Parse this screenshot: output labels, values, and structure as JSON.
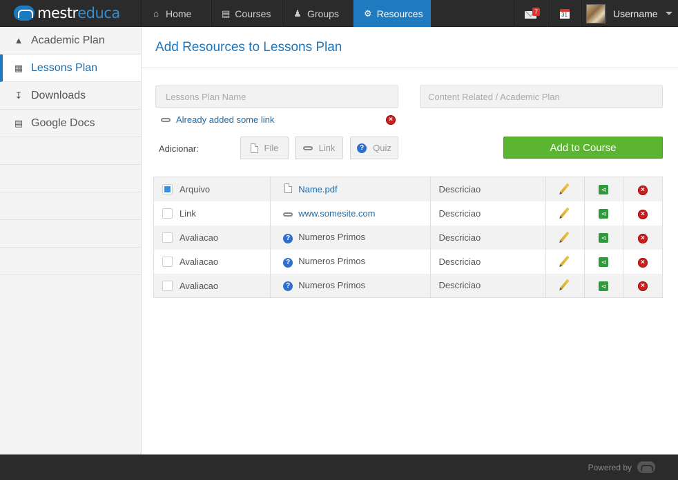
{
  "app": {
    "logo_text_a": "mestr",
    "logo_text_b": "educa"
  },
  "nav": {
    "home": "Home",
    "courses": "Courses",
    "groups": "Groups",
    "resources": "Resources",
    "mail_badge": "7",
    "calendar_day": "31",
    "username": "Username"
  },
  "sidebar": {
    "items": [
      {
        "label": "Academic Plan",
        "icon": "graduation-cap-icon"
      },
      {
        "label": "Lessons Plan",
        "icon": "book-icon"
      },
      {
        "label": "Downloads",
        "icon": "download-icon"
      },
      {
        "label": "Google Docs",
        "icon": "document-icon"
      }
    ]
  },
  "main": {
    "title": "Add Resources to Lessons Plan",
    "lessons_plan_name_placeholder": "Lessons Plan Name",
    "content_related_placeholder": "Content Related / Academic Plan",
    "added_link_text": "Already added some link",
    "adicionar_label": "Adicionar:",
    "btn_file": "File",
    "btn_link": "Link",
    "btn_quiz": "Quiz",
    "btn_add_course": "Add to Course"
  },
  "table": {
    "rows": [
      {
        "type": "Arquivo",
        "name": "Name.pdf",
        "desc": "Descriciao",
        "checked": true
      },
      {
        "type": "Link",
        "name": "www.somesite.com",
        "desc": "Descriciao",
        "checked": false
      },
      {
        "type": "Avaliacao",
        "name": "Numeros Primos",
        "desc": "Descriciao",
        "checked": false
      },
      {
        "type": "Avaliacao",
        "name": "Numeros Primos",
        "desc": "Descriciao",
        "checked": false
      },
      {
        "type": "Avaliacao",
        "name": "Numeros Primos",
        "desc": "Descriciao",
        "checked": false
      }
    ]
  },
  "footer": {
    "powered_by": "Powered by"
  },
  "colors": {
    "accent": "#1f7ac0",
    "success": "#5cb531",
    "danger": "#cc1f1f",
    "topbar": "#2b2b2b"
  }
}
